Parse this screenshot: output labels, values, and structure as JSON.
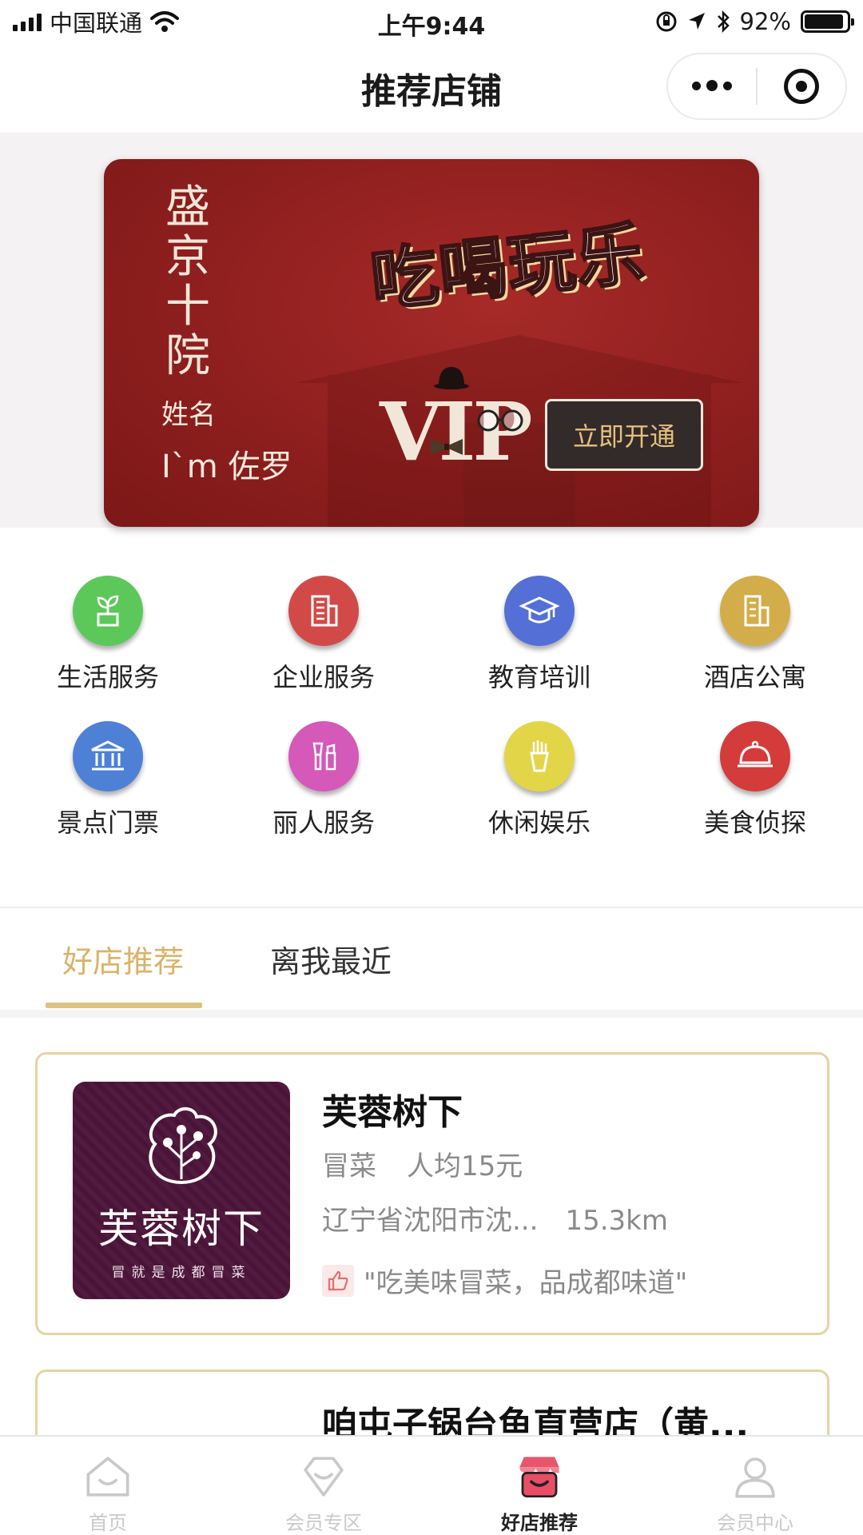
{
  "status_bar": {
    "carrier": "中国联通",
    "time": "上午9:44",
    "battery_percent": "92%",
    "battery_level": 0.92,
    "icons": [
      "signal-icon",
      "wifi-icon",
      "orientation-lock-icon",
      "location-icon",
      "bluetooth-icon",
      "battery-icon"
    ]
  },
  "nav": {
    "title": "推荐店铺",
    "more_icon": "more-dots-icon",
    "close_icon": "target-circle-icon"
  },
  "banner": {
    "brand": "盛京十院",
    "slogan": "吃喝玩乐",
    "badge": "VIP",
    "name_label": "姓名",
    "name_value": "I`m 佐罗",
    "button_label": "立即开通",
    "colors": {
      "background": "#8e1f1e",
      "button_text": "#e5c07e"
    }
  },
  "categories": [
    {
      "label": "生活服务",
      "icon": "plant-icon",
      "color": "#5cc85a"
    },
    {
      "label": "企业服务",
      "icon": "building-icon",
      "color": "#d24a48"
    },
    {
      "label": "教育培训",
      "icon": "graduation-cap-icon",
      "color": "#5470d6"
    },
    {
      "label": "酒店公寓",
      "icon": "hotel-building-icon",
      "color": "#d3ad4a"
    },
    {
      "label": "景点门票",
      "icon": "museum-icon",
      "color": "#4e80d6"
    },
    {
      "label": "丽人服务",
      "icon": "makeup-icon",
      "color": "#d459b9"
    },
    {
      "label": "休闲娱乐",
      "icon": "fries-icon",
      "color": "#e3d548"
    },
    {
      "label": "美食侦探",
      "icon": "food-cloche-icon",
      "color": "#d43b3b"
    }
  ],
  "tabs": [
    {
      "label": "好店推荐",
      "active": true
    },
    {
      "label": "离我最近",
      "active": false
    }
  ],
  "stores": [
    {
      "name": "芙蓉树下",
      "category": "冒菜",
      "avg_price": "人均15元",
      "address": "辽宁省沈阳市沈...",
      "distance": "15.3km",
      "quote": "\"吃美味冒菜，品成都味道\"",
      "logo_name": "芙蓉树下",
      "logo_slogan": "冒就是成都冒菜"
    },
    {
      "name": "咱屯子锅台鱼直营店（黄..."
    }
  ],
  "tabbar": [
    {
      "label": "首页",
      "icon": "home-icon",
      "active": false
    },
    {
      "label": "会员专区",
      "icon": "diamond-icon",
      "active": false
    },
    {
      "label": "好店推荐",
      "icon": "shop-icon",
      "active": true
    },
    {
      "label": "会员中心",
      "icon": "user-icon",
      "active": false
    }
  ],
  "colors": {
    "accent": "#d8b36a",
    "card_border": "#e5d3a6"
  }
}
